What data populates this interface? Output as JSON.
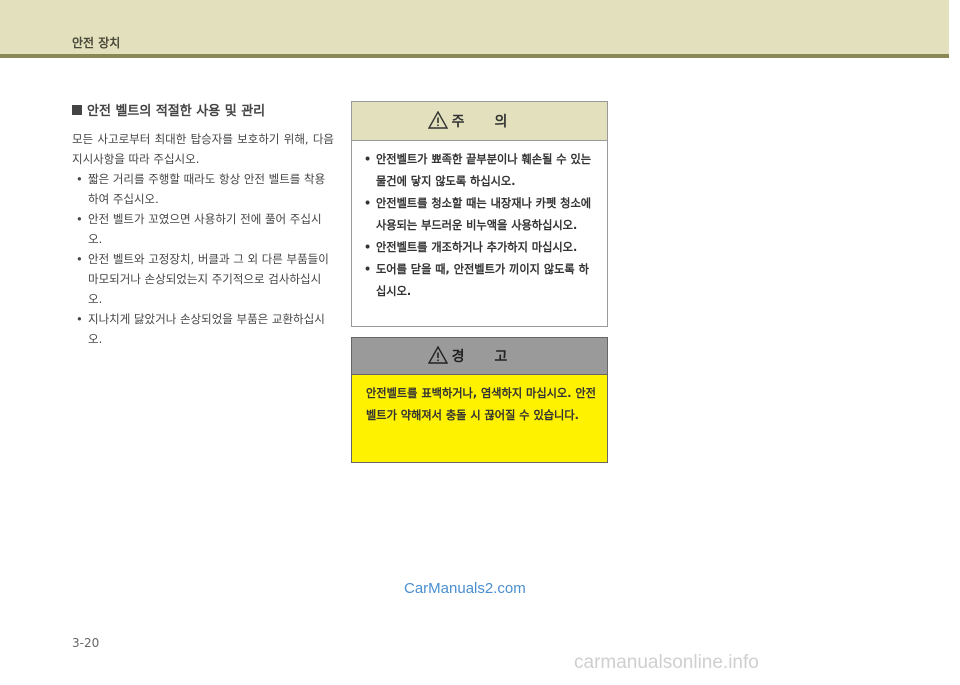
{
  "header": {
    "title": "안전 장치"
  },
  "section": {
    "heading": "안전 벨트의 적절한 사용 및 관리",
    "intro": "모든 사고로부터 최대한 탑승자를 보호하기 위해, 다음 지시사항을 따라 주십시오.",
    "bullets": [
      "짧은 거리를 주행할 때라도 항상 안전 벨트를 착용하여 주십시오.",
      "안전 벨트가 꼬였으면 사용하기 전에 풀어 주십시오.",
      "안전 벨트와 고정장치, 버클과 그 외 다른 부품들이 마모되거나 손상되었는지 주기적으로 검사하십시오.",
      "지나치게 닳았거나 손상되었을 부품은 교환하십시오."
    ]
  },
  "caution": {
    "title": "주의",
    "items": [
      "안전벨트가 뾰족한 끝부분이나 훼손될 수 있는 물건에 닿지 않도록 하십시오.",
      "안전벨트를 청소할 때는 내장재나 카펫 청소에 사용되는 부드러운 비누액을 사용하십시오.",
      "안전벨트를 개조하거나 추가하지 마십시오.",
      "도어를 닫을 때, 안전벨트가 끼이지 않도록 하십시오."
    ]
  },
  "warning": {
    "title": "경고",
    "text": "안전벨트를 표백하거나, 염색하지 마십시오. 안전벨트가 약해져서 충돌 시 끊어질 수 있습니다."
  },
  "page_number": "3-20",
  "watermarks": {
    "site1": "CarManuals2.com",
    "site2": "carmanualsonline.info"
  },
  "colors": {
    "header_band": "#e3e1bd",
    "header_rule": "#8a8956",
    "warning_fill": "#fff200",
    "warning_header": "#9a9a9a"
  },
  "icons": {
    "caution": "warning-triangle-icon",
    "warning": "warning-triangle-icon",
    "heading": "square-bullet-icon"
  }
}
